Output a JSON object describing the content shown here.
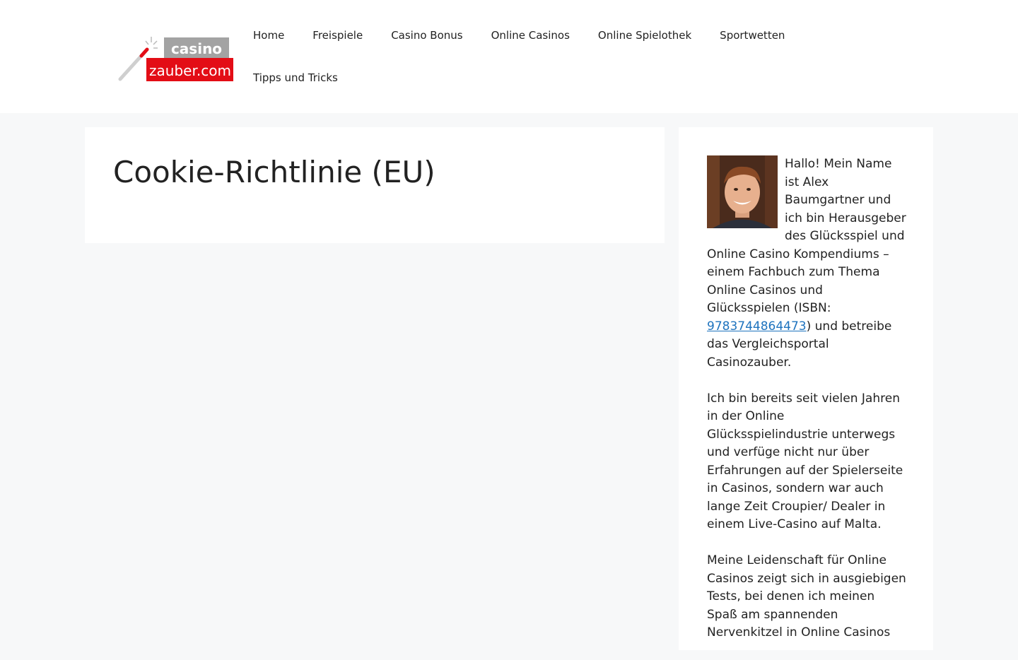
{
  "header": {
    "logo": {
      "line1": "casino",
      "line2": "zauber.com"
    },
    "nav": [
      {
        "label": "Home"
      },
      {
        "label": "Freispiele"
      },
      {
        "label": "Casino Bonus"
      },
      {
        "label": "Online Casinos"
      },
      {
        "label": "Online Spielothek"
      },
      {
        "label": "Sportwetten"
      },
      {
        "label": "Tipps und Tricks"
      }
    ]
  },
  "main": {
    "title": "Cookie-Richtlinie (EU)"
  },
  "sidebar": {
    "bio": {
      "p1_before": "Hallo! Mein Name ist Alex Baumgartner und ich bin Herausgeber des Glücksspiel und Online Casino Kompendiums – einem Fachbuch zum Thema Online Casinos und Glücksspielen (ISBN: ",
      "isbn": "9783744864473",
      "p1_after": ") und betreibe das Vergleichsportal Casinozauber.",
      "p2": "Ich bin bereits seit vielen Jahren in der Online Glücksspielindustrie unterwegs und verfüge nicht nur über Erfahrungen auf der Spielerseite in Casinos, sondern war auch lange Zeit Croupier/ Dealer in einem Live-Casino auf Malta.",
      "p3": "Meine Leidenschaft für Online Casinos zeigt sich in ausgiebigen Tests, bei denen ich meinen Spaß am spannenden Nervenkitzel in Online Casinos"
    }
  },
  "colors": {
    "background": "#f7f8f9",
    "logo_grey": "#a3a3a3",
    "logo_red": "#e30d16",
    "link": "#1e73be"
  }
}
